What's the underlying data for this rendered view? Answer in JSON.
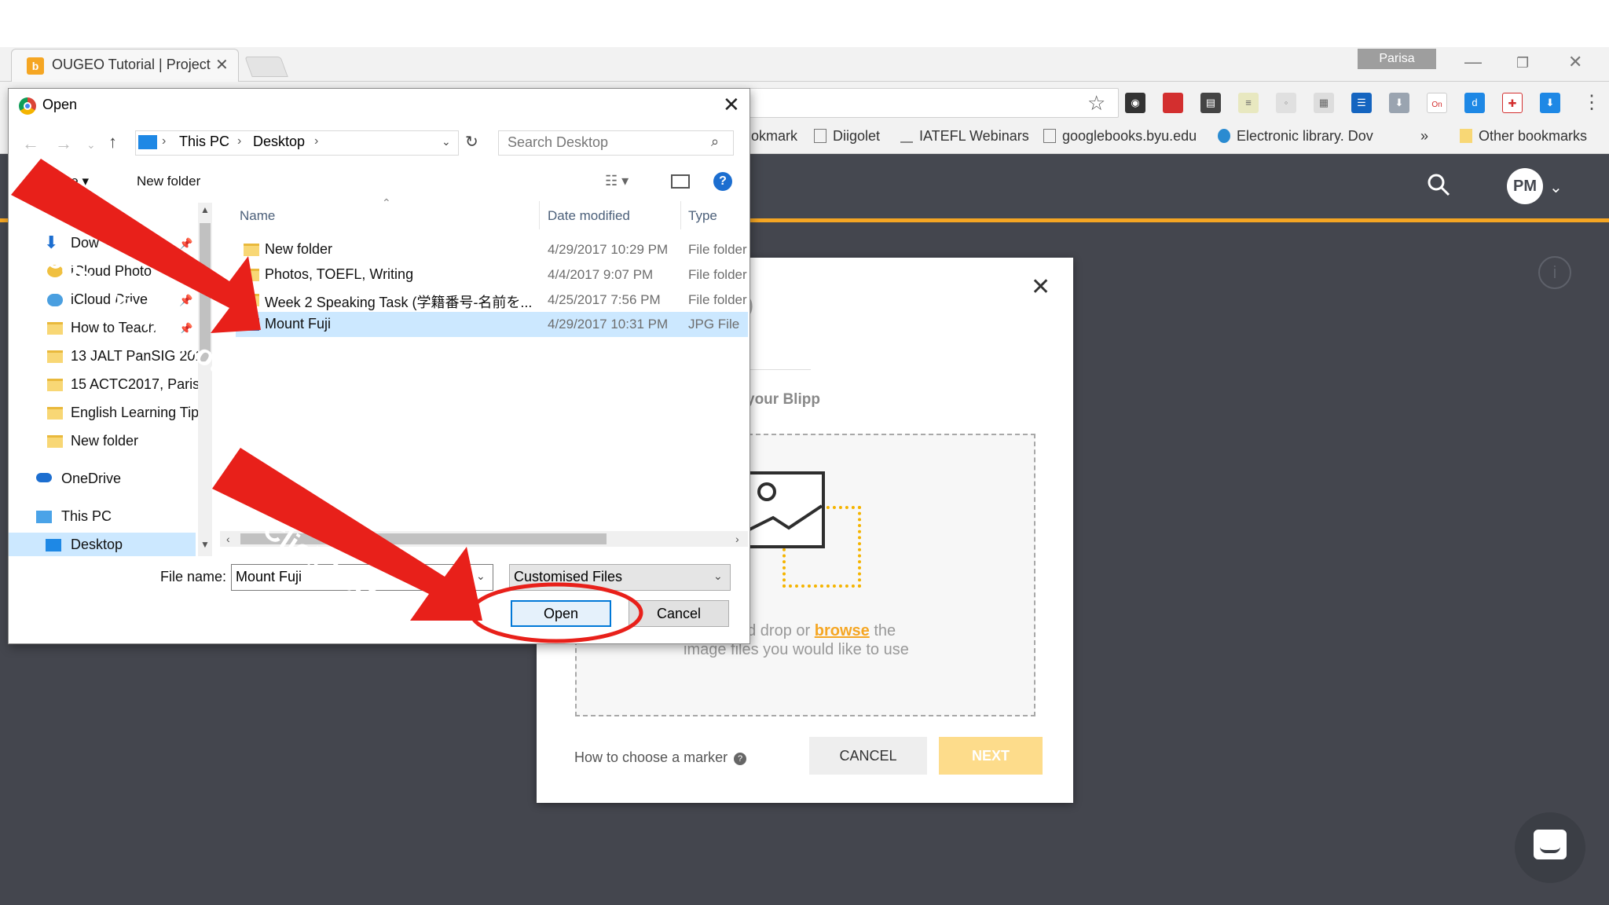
{
  "browser": {
    "tab_title": "OUGEO Tutorial | Project",
    "tab_favicon_letter": "b",
    "profile_name": "Parisa",
    "bookmarks": [
      "okmark",
      "Diigolet",
      "IATEFL Webinars",
      "googlebooks.byu.edu",
      "Electronic library. Dov",
      "Other bookmarks"
    ],
    "bookmarks_overflow": "»",
    "ext_badge": "On"
  },
  "app": {
    "avatar_initials": "PM",
    "blipp_modal": {
      "heading": "your Blipp",
      "drop_text_prefix": "nd drop or",
      "browse_label": "browse",
      "drop_text_suffix": "the",
      "drop_text_line2": "image files you would like to use",
      "how_to": "How to choose a marker",
      "cancel_label": "CANCEL",
      "next_label": "NEXT"
    }
  },
  "dialog": {
    "title": "Open",
    "breadcrumbs": [
      "This PC",
      "Desktop"
    ],
    "search_placeholder": "Search Desktop",
    "toolbar": {
      "organise": "ise",
      "new_folder": "New folder"
    },
    "nav_items": [
      "Dow",
      "iCloud Photo",
      "iCloud Drive",
      "How to Teach",
      "13 JALT PanSIG 2017",
      "15 ACTC2017, Parisa",
      "English Learning Tip",
      "New folder",
      "OneDrive",
      "This PC",
      "Desktop"
    ],
    "columns": [
      "Name",
      "Date modified",
      "Type"
    ],
    "files": [
      {
        "name": "New folder",
        "date": "4/29/2017 10:29 PM",
        "type": "File folder"
      },
      {
        "name": "Photos, TOEFL, Writing",
        "date": "4/4/2017 9:07 PM",
        "type": "File folder"
      },
      {
        "name": "Week 2 Speaking Task (学籍番号-名前を...",
        "date": "4/25/2017 7:56 PM",
        "type": "File folder"
      },
      {
        "name": "Mount Fuji",
        "date": "4/29/2017 10:31 PM",
        "type": "JPG File"
      }
    ],
    "filename_label": "File name:",
    "filename_value": "Mount Fuji",
    "filetype_value": "Customised Files",
    "open_label": "Open",
    "cancel_label": "Cancel"
  },
  "annotations": {
    "choose": "Choose your photo",
    "click": "Click here",
    "arrow_color": "#e8201a"
  }
}
